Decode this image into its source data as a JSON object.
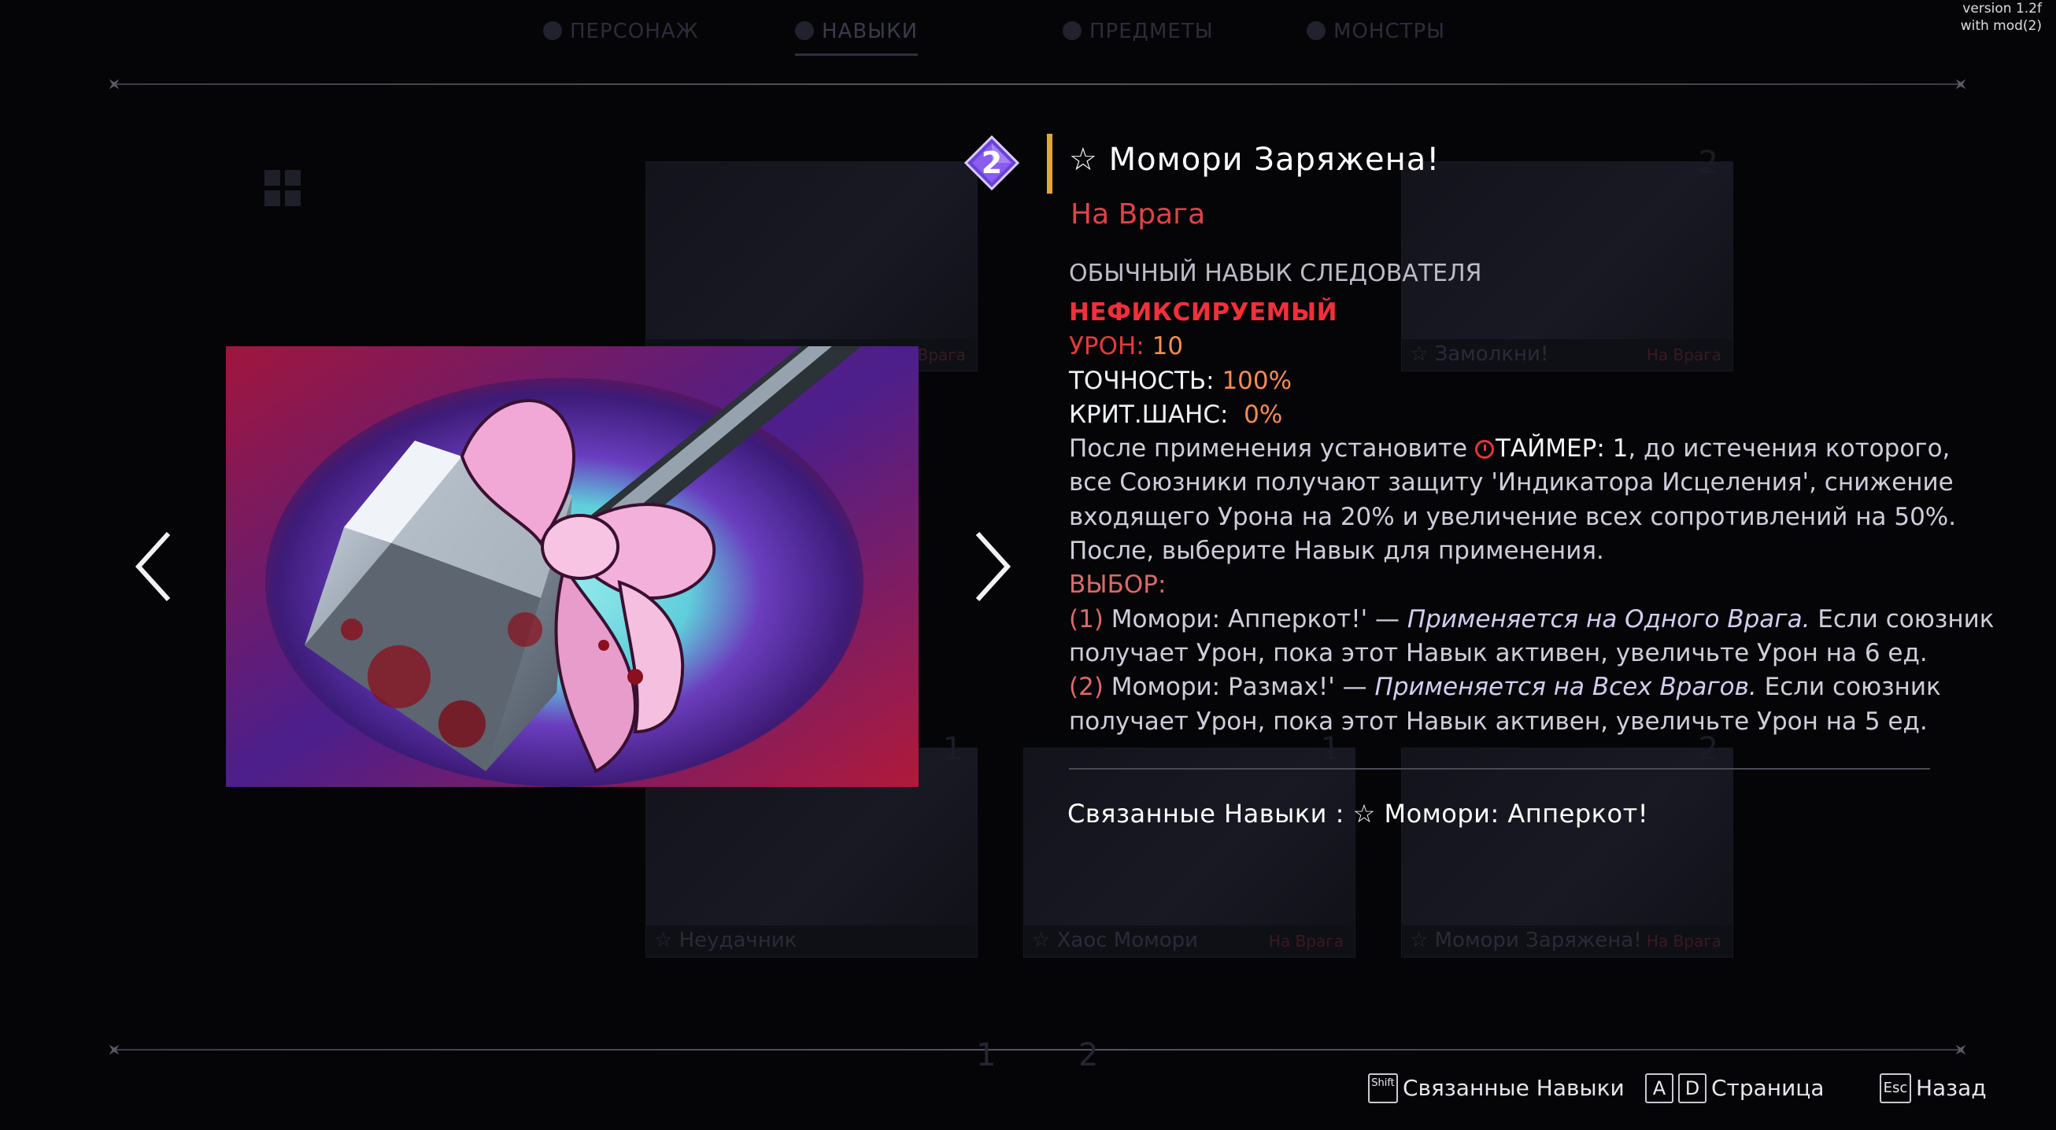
{
  "version": {
    "line1": "version 1.2f",
    "line2": "with mod(2)"
  },
  "tabs": [
    {
      "label": "ПЕРСОНАЖ",
      "icon": "person-icon"
    },
    {
      "label": "НАВЫКИ",
      "icon": "skills-icon",
      "active": true
    },
    {
      "label": "ПРЕДМЕТЫ",
      "icon": "item-icon"
    },
    {
      "label": "МОНСТРЫ",
      "icon": "monster-icon"
    }
  ],
  "background_cards": [
    {
      "caption": "",
      "tag": "Врага"
    },
    {
      "caption": "☆ Замолкни!",
      "tag": "На Врага",
      "cost": "2"
    },
    {
      "caption": "☆ Неудачник",
      "tag": "",
      "cost": "1"
    },
    {
      "caption": "☆ Хаос Момори",
      "tag": "На Врага",
      "cost": "1"
    },
    {
      "caption": "☆ Момори Заряжена!",
      "tag": "На Врага",
      "cost": "2"
    }
  ],
  "skill": {
    "cost": "2",
    "title": "☆ Момори Заряжена!",
    "target": "На Врага",
    "category": "ОБЫЧНЫЙ НАВЫК СЛЕДОВАТЕЛЯ",
    "unfixable": "НЕФИКСИРУЕМЫЙ",
    "damage_label": "УРОН:",
    "damage_value": "10",
    "accuracy_label": "ТОЧНОСТЬ:",
    "accuracy_value": "100%",
    "crit_label": "КРИТ.ШАНС:",
    "crit_value": "0%",
    "desc_part1": "После применения установите ",
    "timer_label": "ТАЙМЕР: 1",
    "desc_part2": ", до истечения которого,",
    "desc_line2": "все Союзники получают защиту 'Индикатора Исцеления', снижение",
    "desc_line3": "входящего Урона на 20% и увеличение всех сопротивлений на 50%.",
    "desc_line4": "После, выберите Навык для применения.",
    "choice_label": "ВЫБОР:",
    "choice1_num": "(1)",
    "choice1_name": "Момори: Апперкот!' — ",
    "choice1_target": "Применяется на Одного Врага.",
    "choice1_rest": " Если союзник",
    "choice1_line2": "получает Урон, пока этот Навык активен, увеличьте Урон на 6 ед.",
    "choice2_num": "(2)",
    "choice2_name": "Момори: Размах!' — ",
    "choice2_target": "Применяется на Всех Врагов.",
    "choice2_rest": " Если союзник",
    "choice2_line2": "получает Урон, пока этот Навык активен, увеличьте Урон на 5 ед.",
    "related": "Связанные Навыки : ☆ Момори: Апперкот!"
  },
  "pager": {
    "page1": "1",
    "page2": "2"
  },
  "hints": {
    "shift_key": "Shift",
    "related_label": "Связанные Навыки",
    "key_a": "A",
    "key_d": "D",
    "page_label": "Страница",
    "esc_key": "Esc",
    "back_label": "Назад"
  },
  "colors": {
    "accent_gold": "#e2a73c",
    "target_red": "#e0424a",
    "value_orange": "#f48b57",
    "gem_purple": "#8a5cf0"
  }
}
